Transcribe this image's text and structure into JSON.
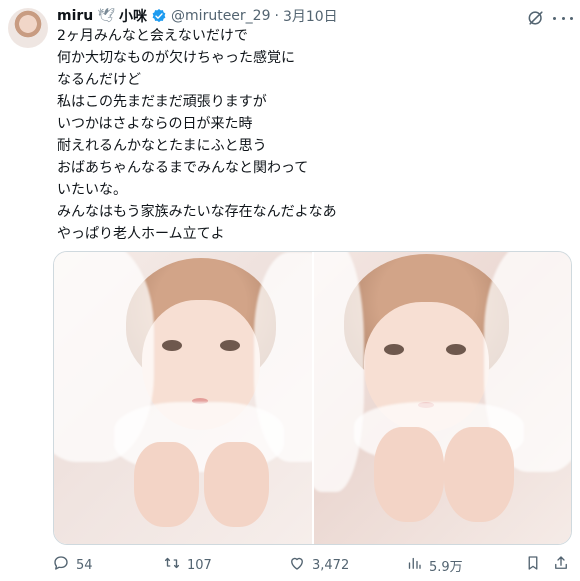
{
  "author": {
    "name": "miru",
    "emoji": "🕊",
    "name2": "小咪",
    "handle": "@miruteer_29",
    "separator": "·",
    "date": "3月10日"
  },
  "tweet": {
    "lines": [
      "2ヶ月みんなと会えないだけで",
      "何か大切なものが欠けちゃった感覚に",
      "なるんだけど",
      "私はこの先まだまだ頑張りますが",
      "いつかはさよならの日が来た時",
      "耐えれるんかなとたまにふと思う",
      "おばあちゃんなるまでみんなと関わって",
      "いたいな。",
      "みんなはもう家族みたいな存在なんだよなあ",
      "やっぱり老人ホーム立てよ"
    ]
  },
  "actions": {
    "replies": "54",
    "reposts": "107",
    "likes": "3,472",
    "views": "5.9万"
  },
  "colors": {
    "text": "#0f1419",
    "secondary": "#536471",
    "verified": "#1d9bf0",
    "border": "#cfd9de"
  },
  "icons": [
    "grok-icon",
    "more-icon",
    "verified-badge-icon",
    "reply-icon",
    "repost-icon",
    "like-icon",
    "views-icon",
    "share-icon"
  ]
}
